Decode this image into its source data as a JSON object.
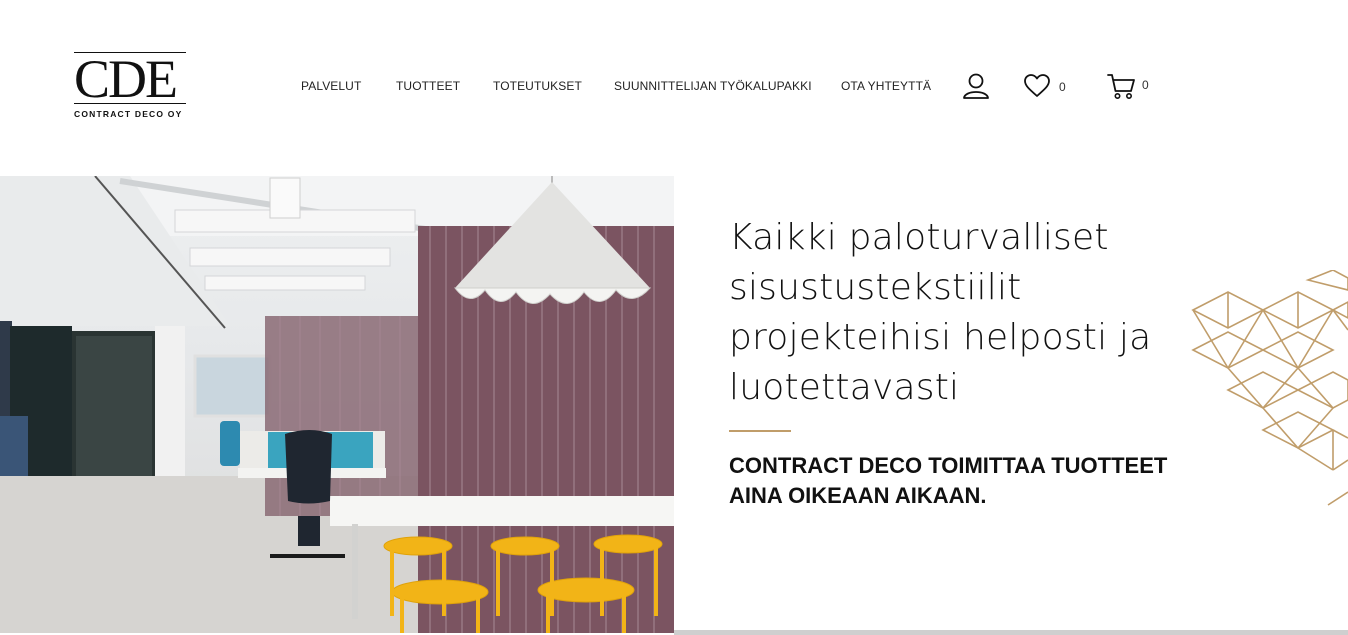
{
  "brand": {
    "logo_letters": "CDE",
    "logo_o": "O",
    "logo_sub": "CONTRACT DECO OY",
    "accent_color": "#c09d6a"
  },
  "nav": {
    "items": [
      {
        "label": "PALVELUT"
      },
      {
        "label": "TUOTTEET"
      },
      {
        "label": "TOTEUTUKSET"
      },
      {
        "label": "SUUNNITTELIJAN TYÖKALUPAKKI"
      },
      {
        "label": "OTA YHTEYTTÄ"
      }
    ]
  },
  "actions": {
    "account_icon": "user-icon",
    "wishlist_icon": "heart-icon",
    "wishlist_count": "0",
    "cart_icon": "cart-icon",
    "cart_count": "0"
  },
  "hero": {
    "title": "Kaikki paloturvalliset sisustustekstiilit projekteihisi helposti ja luotettavasti",
    "subtitle": "CONTRACT DECO TOIMITTAA TUOTTEET AINA OIKEAAN AIKAAN.",
    "image_subject": "office interior with pleated pendant lamp, mauve curtains, white desks and yellow stools"
  }
}
